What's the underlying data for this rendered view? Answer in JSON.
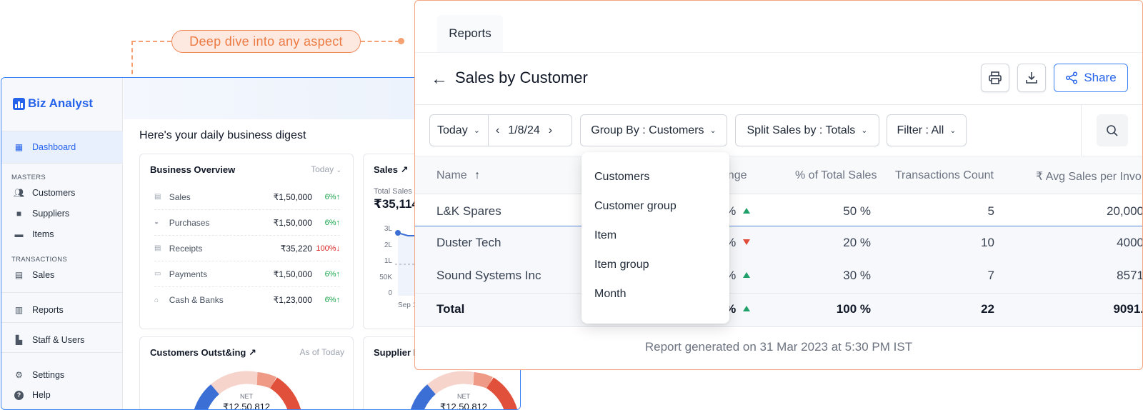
{
  "callout": {
    "text": "Deep dive into any aspect"
  },
  "dashboard": {
    "brand": "Biz Analyst",
    "digest_title": "Here's your daily business digest",
    "nav": {
      "dashboard": "Dashboard",
      "masters_heading": "MASTERS",
      "customers": "Customers",
      "suppliers": "Suppliers",
      "items": "Items",
      "transactions_heading": "TRANSACTIONS",
      "sales": "Sales",
      "reports": "Reports",
      "staff": "Staff & Users",
      "settings": "Settings",
      "help": "Help"
    },
    "overview": {
      "title": "Business Overview",
      "period": "Today",
      "rows": [
        {
          "label": "Sales",
          "value": "₹1,50,000",
          "pct": "6%↑"
        },
        {
          "label": "Purchases",
          "value": "₹1,50,000",
          "pct": "6%↑"
        },
        {
          "label": "Receipts",
          "value": "₹35,220",
          "pct": "100%↓"
        },
        {
          "label": "Payments",
          "value": "₹1,50,000",
          "pct": "6%↑"
        },
        {
          "label": "Cash & Banks",
          "value": "₹1,23,000",
          "pct": "6%↑"
        }
      ]
    },
    "sales_card": {
      "title": "Sales ↗",
      "subtitle": "Total Sales",
      "value": "₹35,114",
      "y_ticks": [
        "3L",
        "2L",
        "1L",
        "50K",
        "0"
      ],
      "x_tick": "Sep 1"
    },
    "customers_card": {
      "title": "Customers Outst&ing ↗",
      "period": "As of Today",
      "net_label": "NET",
      "net_value": "₹12,50,812"
    },
    "supplier_card": {
      "title": "Supplier I",
      "net_label": "NET",
      "net_value": "₹12,50,812"
    }
  },
  "reports": {
    "tab": "Reports",
    "title": "Sales by Customer",
    "share": "Share",
    "filters": {
      "period": "Today",
      "date": "1/8/24",
      "group_by": "Group By : Customers",
      "split": "Split Sales by : Totals",
      "filter": "Filter : All"
    },
    "columns": {
      "name": "Name",
      "change": "hange",
      "pct_total": "% of Total Sales",
      "tx_count": "Transactions Count",
      "avg": "₹ Avg Sales per Invo"
    },
    "rows": [
      {
        "name": "L&K Spares",
        "change": "5 %",
        "pct": "50 %",
        "count": "5",
        "avg": "20,000"
      },
      {
        "name": "Duster Tech",
        "change": "0 %",
        "pct": "20 %",
        "count": "10",
        "avg": "4000"
      },
      {
        "name": "Sound Systems Inc",
        "change": "5 %",
        "pct": "30 %",
        "count": "7",
        "avg": "8571"
      }
    ],
    "total": {
      "name": "Total",
      "change": "3 %",
      "pct": "100 %",
      "count": "22",
      "avg": "9091."
    },
    "group_by_options": [
      "Customers",
      "Customer group",
      "Item",
      "Item group",
      "Month"
    ],
    "footer": "Report generated on 31 Mar 2023 at 5:30 PM IST"
  }
}
